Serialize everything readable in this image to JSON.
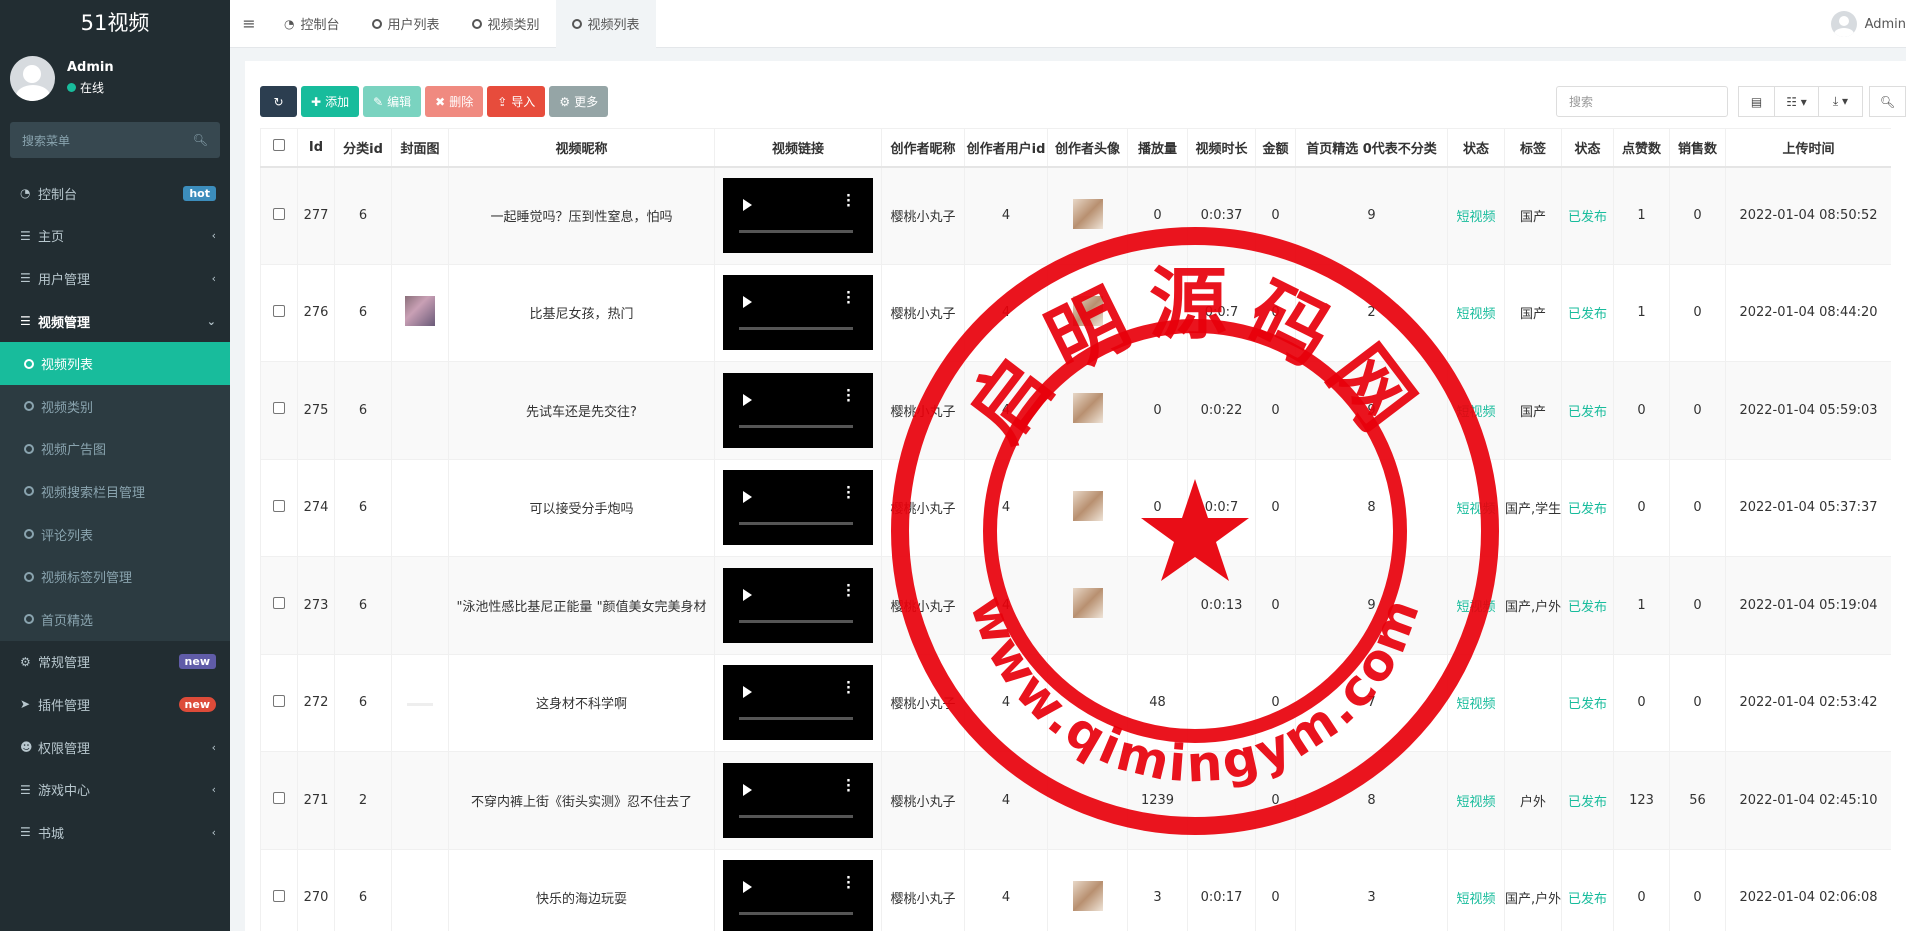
{
  "app": {
    "title": "51视频"
  },
  "user": {
    "name": "Admin",
    "status": "在线"
  },
  "sidebar_search": {
    "placeholder": "搜索菜单"
  },
  "menu": {
    "dashboard": {
      "label": "控制台",
      "badge": "hot"
    },
    "home": {
      "label": "主页"
    },
    "user_mgmt": {
      "label": "用户管理"
    },
    "video_mgmt": {
      "label": "视频管理"
    },
    "sub": {
      "video_list": "视频列表",
      "video_category": "视频类别",
      "video_ads": "视频广告图",
      "video_search_column": "视频搜索栏目管理",
      "comments": "评论列表",
      "video_tags": "视频标签列管理",
      "featured": "首页精选"
    },
    "general": {
      "label": "常规管理",
      "badge": "new"
    },
    "plugins": {
      "label": "插件管理",
      "badge": "new"
    },
    "permissions": {
      "label": "权限管理"
    },
    "games": {
      "label": "游戏中心"
    },
    "books": {
      "label": "书城"
    }
  },
  "tabs": [
    "控制台",
    "用户列表",
    "视频类别",
    "视频列表"
  ],
  "top_user": {
    "name": "Admin"
  },
  "toolbar": {
    "add": "添加",
    "edit": "编辑",
    "delete": "删除",
    "import": "导入",
    "more": "更多",
    "search_placeholder": "搜索"
  },
  "table": {
    "headers": [
      "Id",
      "分类id",
      "封面图",
      "视频昵称",
      "视频链接",
      "创作者昵称",
      "创作者用户id",
      "创作者头像",
      "播放量",
      "视频时长",
      "金额",
      "首页精选 0代表不分类",
      "状态",
      "标签",
      "状态",
      "点赞数",
      "销售数",
      "上传时间"
    ],
    "rows": [
      {
        "id": "277",
        "cat": "6",
        "title": "一起睡觉吗？压到性窒息，怕吗",
        "creator": "樱桃小丸子",
        "creator_id": "4",
        "plays": "0",
        "duration": "0:0:37",
        "amount": "0",
        "featured": "9",
        "type": "短视频",
        "tags": "国产",
        "status": "已发布",
        "likes": "1",
        "sales": "0",
        "time": "2022-01-04 08:50:52"
      },
      {
        "id": "276",
        "cat": "6",
        "title": "比基尼女孩，热门",
        "creator": "樱桃小丸子",
        "creator_id": "4",
        "plays": "",
        "duration": "0:0:7",
        "amount": "0",
        "featured": "2",
        "type": "短视频",
        "tags": "国产",
        "status": "已发布",
        "likes": "1",
        "sales": "0",
        "time": "2022-01-04 08:44:20"
      },
      {
        "id": "275",
        "cat": "6",
        "title": "先试车还是先交往?",
        "creator": "樱桃小丸子",
        "creator_id": "4",
        "plays": "0",
        "duration": "0:0:22",
        "amount": "0",
        "featured": "9",
        "type": "短视频",
        "tags": "国产",
        "status": "已发布",
        "likes": "0",
        "sales": "0",
        "time": "2022-01-04 05:59:03"
      },
      {
        "id": "274",
        "cat": "6",
        "title": "可以接受分手炮吗",
        "creator": "樱桃小丸子",
        "creator_id": "4",
        "plays": "0",
        "duration": "0:0:7",
        "amount": "0",
        "featured": "8",
        "type": "短视频",
        "tags": "国产,学生",
        "status": "已发布",
        "likes": "0",
        "sales": "0",
        "time": "2022-01-04 05:37:37"
      },
      {
        "id": "273",
        "cat": "6",
        "title": "\"泳池性感比基尼正能量 \"颜值美女完美身材",
        "creator": "樱桃小丸子",
        "creator_id": "4",
        "plays": "",
        "duration": "0:0:13",
        "amount": "0",
        "featured": "9",
        "type": "短视频",
        "tags": "国产,户外",
        "status": "已发布",
        "likes": "1",
        "sales": "0",
        "time": "2022-01-04 05:19:04"
      },
      {
        "id": "272",
        "cat": "6",
        "title": "这身材不科学啊",
        "creator": "樱桃小丸子",
        "creator_id": "4",
        "plays": "48",
        "duration": "",
        "amount": "0",
        "featured": "7",
        "type": "短视频",
        "tags": "",
        "status": "已发布",
        "likes": "0",
        "sales": "0",
        "time": "2022-01-04 02:53:42"
      },
      {
        "id": "271",
        "cat": "2",
        "title": "不穿内裤上街《街头实测》忍不住去了",
        "creator": "樱桃小丸子",
        "creator_id": "4",
        "plays": "1239",
        "duration": "",
        "amount": "0",
        "featured": "8",
        "type": "短视频",
        "tags": "户外",
        "status": "已发布",
        "likes": "123",
        "sales": "56",
        "time": "2022-01-04 02:45:10"
      },
      {
        "id": "270",
        "cat": "6",
        "title": "快乐的海边玩耍",
        "creator": "樱桃小丸子",
        "creator_id": "4",
        "plays": "3",
        "duration": "0:0:17",
        "amount": "0",
        "featured": "3",
        "type": "短视频",
        "tags": "国产,户外",
        "status": "已发布",
        "likes": "0",
        "sales": "0",
        "time": "2022-01-04 02:06:08"
      }
    ]
  },
  "watermark": {
    "text_top": "启明源码网",
    "text_bottom": "www.qimingym.com",
    "color": "#e8000b"
  }
}
